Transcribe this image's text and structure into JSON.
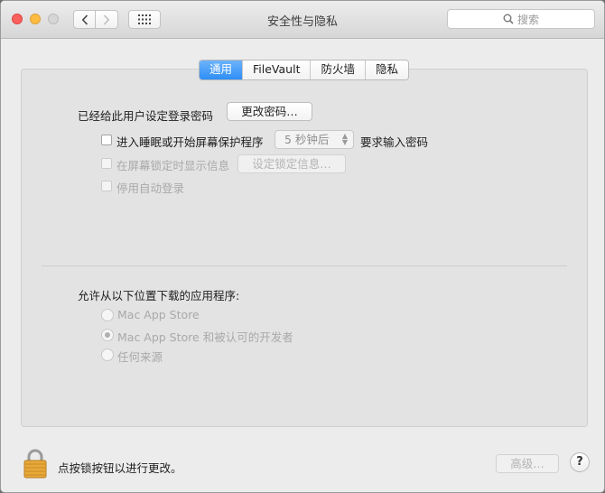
{
  "window": {
    "title": "安全性与隐私",
    "search_placeholder": "搜索"
  },
  "tabs": [
    {
      "label": "通用",
      "active": true
    },
    {
      "label": "FileVault",
      "active": false
    },
    {
      "label": "防火墙",
      "active": false
    },
    {
      "label": "隐私",
      "active": false
    }
  ],
  "general": {
    "password_label": "已经给此用户设定登录密码",
    "change_password_button": "更改密码…",
    "require_password_checkbox_label": "进入睡眠或开始屏幕保护程序",
    "require_password_checked": false,
    "require_password_delay": "5 秒钟后",
    "require_password_suffix": "要求输入密码",
    "show_message_checkbox_label": "在屏幕锁定时显示信息",
    "show_message_checked": false,
    "set_lock_message_button": "设定锁定信息…",
    "disable_autologin_checkbox_label": "停用自动登录",
    "disable_autologin_checked": false
  },
  "downloads": {
    "heading": "允许从以下位置下载的应用程序:",
    "options": [
      {
        "label": "Mac App Store",
        "selected": false
      },
      {
        "label": "Mac App Store 和被认可的开发者",
        "selected": true
      },
      {
        "label": "任何来源",
        "selected": false
      }
    ]
  },
  "footer": {
    "lock_message": "点按锁按钮以进行更改。",
    "advanced_button": "高级…",
    "help_button": "?"
  },
  "colors": {
    "accent": "#2e8ef6",
    "lock_gold": "#e8a93a"
  }
}
